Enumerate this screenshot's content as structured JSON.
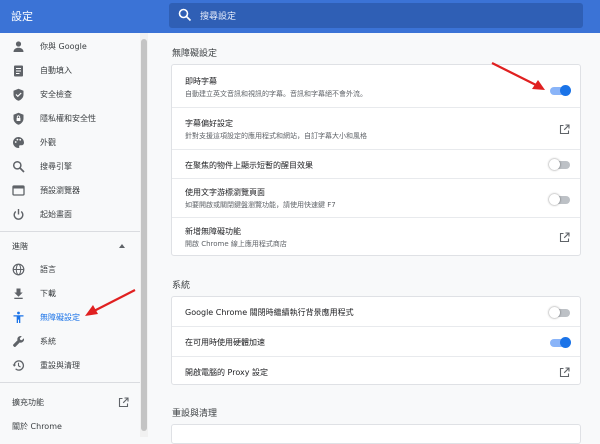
{
  "app": {
    "title": "設定"
  },
  "search": {
    "placeholder": "搜尋設定"
  },
  "sidebar": {
    "items": [
      {
        "label": "你與 Google"
      },
      {
        "label": "自動填入"
      },
      {
        "label": "安全檢查"
      },
      {
        "label": "隱私權和安全性"
      },
      {
        "label": "外觀"
      },
      {
        "label": "搜尋引擎"
      },
      {
        "label": "預設瀏覽器"
      },
      {
        "label": "起始畫面"
      }
    ],
    "advanced_label": "進階",
    "advanced_items": [
      {
        "label": "語言"
      },
      {
        "label": "下載"
      },
      {
        "label": "無障礙設定"
      },
      {
        "label": "系統"
      },
      {
        "label": "重設與清理"
      }
    ],
    "extensions_label": "擴充功能",
    "about_label": "關於 Chrome"
  },
  "accessibility": {
    "title": "無障礙設定",
    "rows": [
      {
        "title": "即時字幕",
        "sub": "自動建立英文音訊和視訊的字幕。音訊和字幕絕不會外流。",
        "control": "toggle",
        "on": true
      },
      {
        "title": "字幕偏好設定",
        "sub": "針對支援這項設定的應用程式和網站，自訂字幕大小和風格",
        "control": "external"
      },
      {
        "title": "在聚焦的物件上顯示短暫的醒目效果",
        "control": "toggle",
        "on": false
      },
      {
        "title": "使用文字游標瀏覽頁面",
        "sub": "如要開啟或關閉鍵盤瀏覽功能，請使用快速鍵 F7",
        "control": "toggle",
        "on": false
      },
      {
        "title": "新增無障礙功能",
        "sub": "開啟 Chrome 線上應用程式商店",
        "control": "external"
      }
    ]
  },
  "system": {
    "title": "系統",
    "rows": [
      {
        "title": "Google Chrome 關閉時繼續執行背景應用程式",
        "control": "toggle",
        "on": false
      },
      {
        "title": "在可用時使用硬體加速",
        "control": "toggle",
        "on": true
      },
      {
        "title": "開啟電腦的 Proxy 設定",
        "control": "external"
      }
    ]
  },
  "reset": {
    "title": "重設與清理"
  },
  "colors": {
    "header": "#3b73d6",
    "accent": "#1a73e8",
    "annotation_arrow": "#e02020"
  }
}
